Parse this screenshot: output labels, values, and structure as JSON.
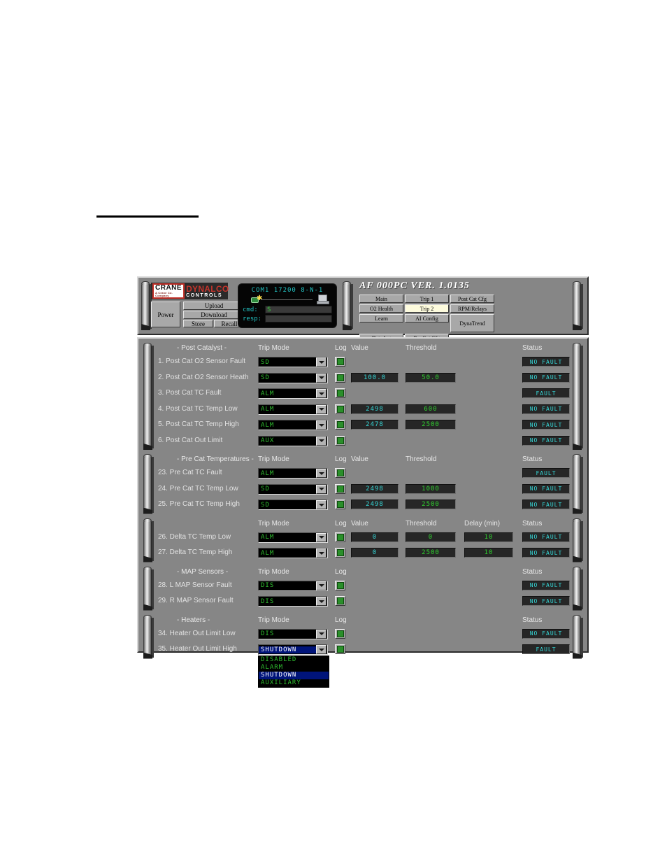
{
  "header": {
    "logo": {
      "crane": "CRANE",
      "crane_sub": "A Crane Co. Company",
      "dynalco": "DYNALCO",
      "controls": "CONTROLS"
    },
    "buttons": {
      "power": "Power",
      "upload": "Upload",
      "download": "Download",
      "store": "Store",
      "recall": "Recall"
    },
    "comm": {
      "title": "COM1 17200 8-N-1",
      "cmd_label": "cmd:",
      "cmd_value": "S",
      "resp_label": "resp:",
      "resp_value": ""
    },
    "app_title": "AF 000PC   VER. 1.0135",
    "tabs": [
      {
        "label": "Main",
        "active": false
      },
      {
        "label": "Trip 1",
        "active": false
      },
      {
        "label": "Post Cat Cfg",
        "active": false
      },
      {
        "label": "O2 Health",
        "active": false
      },
      {
        "label": "Trip 2",
        "active": true
      },
      {
        "label": "RPM/Relays",
        "active": false
      },
      {
        "label": "Learn",
        "active": false
      },
      {
        "label": "AI Config",
        "active": false
      },
      {
        "label": "DynaTrend",
        "active": false
      },
      {
        "label": "Data log",
        "active": false
      },
      {
        "label": "Pre Cat Cfg",
        "active": false
      }
    ]
  },
  "columns": {
    "trip_mode": "Trip Mode",
    "log": "Log",
    "value": "Value",
    "threshold": "Threshold",
    "delay": "Delay (min)",
    "status": "Status"
  },
  "colors": {
    "lcd_value": "#35d6d6",
    "lcd_threshold": "#2fd02f",
    "combo_text": "#2fbd2f",
    "accent_red": "#c4342c",
    "panel": "#868686",
    "highlight": "#00147a"
  },
  "dropdown": {
    "options": [
      "DISABLED",
      "ALARM",
      "SHUTDOWN",
      "AUXILIARY"
    ],
    "selected": "SHUTDOWN"
  },
  "groups": [
    {
      "title": "- Post Catalyst -",
      "show_headers": true,
      "rows": [
        {
          "label": "1. Post Cat O2 Sensor Fault",
          "mode": "SD",
          "log": true,
          "value": "",
          "threshold": "",
          "delay": "",
          "status": "NO FAULT"
        },
        {
          "label": "2. Post Cat O2 Sensor Heath",
          "mode": "SD",
          "log": true,
          "value": "100.0",
          "threshold": "50.0",
          "delay": "",
          "status": "NO FAULT"
        },
        {
          "label": "3. Post Cat TC Fault",
          "mode": "ALM",
          "log": true,
          "value": "",
          "threshold": "",
          "delay": "",
          "status": "FAULT"
        },
        {
          "label": "4. Post Cat TC Temp Low",
          "mode": "ALM",
          "log": true,
          "value": "2498",
          "threshold": "600",
          "delay": "",
          "status": "NO FAULT"
        },
        {
          "label": "5. Post Cat TC Temp High",
          "mode": "ALM",
          "log": true,
          "value": "2478",
          "threshold": "2500",
          "delay": "",
          "status": "NO FAULT"
        },
        {
          "label": "6. Post Cat Out Limit",
          "mode": "AUX",
          "log": true,
          "value": "",
          "threshold": "",
          "delay": "",
          "status": "NO FAULT"
        }
      ]
    },
    {
      "title": "- Pre Cat Temperatures -",
      "show_headers": true,
      "rows": [
        {
          "label": "23. Pre Cat TC Fault",
          "mode": "ALM",
          "log": true,
          "value": "",
          "threshold": "",
          "delay": "",
          "status": "FAULT"
        },
        {
          "label": "24. Pre Cat TC Temp Low",
          "mode": "SD",
          "log": true,
          "value": "2498",
          "threshold": "1000",
          "delay": "",
          "status": "NO FAULT"
        },
        {
          "label": "25. Pre Cat TC Temp High",
          "mode": "SD",
          "log": true,
          "value": "2498",
          "threshold": "2500",
          "delay": "",
          "status": "NO FAULT"
        }
      ]
    },
    {
      "title": "",
      "show_headers": true,
      "rows": [
        {
          "label": "26. Delta TC Temp Low",
          "mode": "ALM",
          "log": true,
          "value": "0",
          "threshold": "0",
          "delay": "10",
          "status": "NO FAULT"
        },
        {
          "label": "27. Delta TC Temp High",
          "mode": "ALM",
          "log": true,
          "value": "0",
          "threshold": "2500",
          "delay": "10",
          "status": "NO FAULT"
        }
      ]
    },
    {
      "title": "- MAP Sensors -",
      "show_headers": true,
      "rows": [
        {
          "label": "28. L MAP Sensor Fault",
          "mode": "DIS",
          "log": true,
          "value": "",
          "threshold": "",
          "delay": "",
          "status": "NO FAULT"
        },
        {
          "label": "29. R MAP Sensor Fault",
          "mode": "DIS",
          "log": true,
          "value": "",
          "threshold": "",
          "delay": "",
          "status": "NO FAULT"
        }
      ]
    },
    {
      "title": "- Heaters -",
      "show_headers": true,
      "rows": [
        {
          "label": "34. Heater Out Limit Low",
          "mode": "DIS",
          "log": true,
          "value": "",
          "threshold": "",
          "delay": "",
          "status": "NO FAULT"
        },
        {
          "label": "35. Heater Out Limit High",
          "mode": "SHUTDOWN",
          "log": true,
          "value": "",
          "threshold": "",
          "delay": "",
          "status": "FAULT",
          "open": true
        }
      ]
    }
  ]
}
